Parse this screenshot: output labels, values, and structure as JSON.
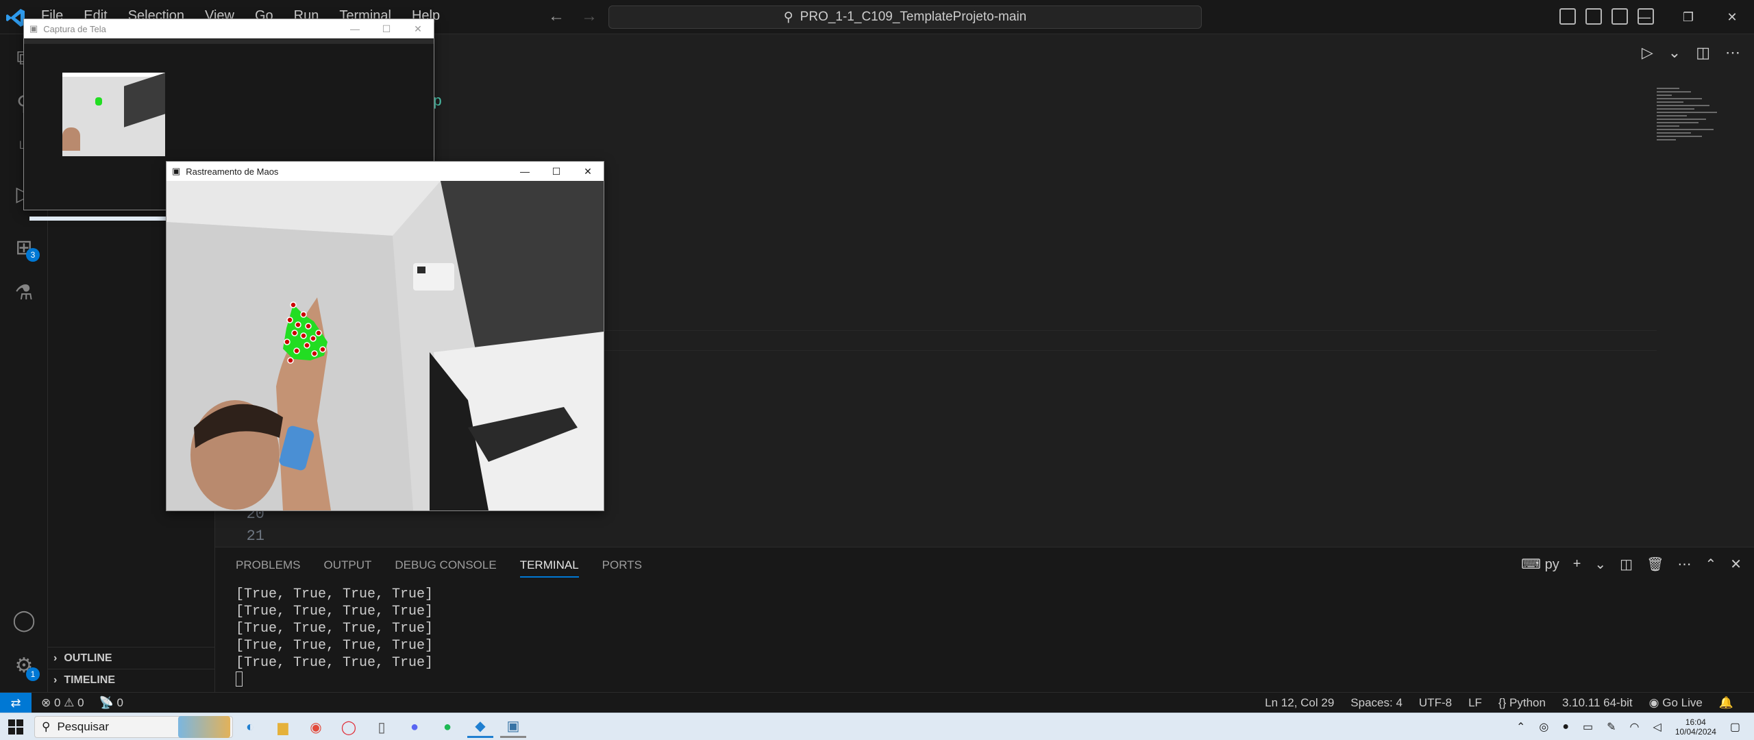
{
  "titlebar": {
    "menu": [
      "File",
      "Edit",
      "Selection",
      "View",
      "Go",
      "Run",
      "Terminal",
      "Help"
    ],
    "search_text": "PRO_1-1_C109_TemplateProjeto-main"
  },
  "activity": {
    "extensions_badge": "3",
    "settings_badge": "1"
  },
  "sidebar": {
    "outline_label": "OUTLINE",
    "timeline_label": "TIMELINE"
  },
  "editor": {
    "line_numbers": [
      "20",
      "21"
    ],
    "visible_fragment": "p"
  },
  "panel": {
    "tabs": [
      "PROBLEMS",
      "OUTPUT",
      "DEBUG CONSOLE",
      "TERMINAL",
      "PORTS"
    ],
    "active_tab": "TERMINAL",
    "terminal_profile": "py",
    "terminal_lines": [
      "[True, True, True, True]",
      "[True, True, True, True]",
      "[True, True, True, True]",
      "[True, True, True, True]",
      "[True, True, True, True]"
    ]
  },
  "statusbar": {
    "errors": "0",
    "warnings": "0",
    "ports": "0",
    "position": "Ln 12, Col 29",
    "spaces": "Spaces: 4",
    "encoding": "UTF-8",
    "eol": "LF",
    "language": "Python",
    "interpreter": "3.10.11 64-bit",
    "golive": "Go Live"
  },
  "windows": {
    "capture_title": "Captura de Tela",
    "tracking_title": "Rastreamento de Maos"
  },
  "taskbar": {
    "search_label": "Pesquisar",
    "time": "16:04",
    "date": "10/04/2024"
  },
  "colors": {
    "accent": "#0078d4",
    "landmark_fill": "#cc0000",
    "hand_overlay": "#22dd22",
    "terminal_text": "#cccccc"
  }
}
